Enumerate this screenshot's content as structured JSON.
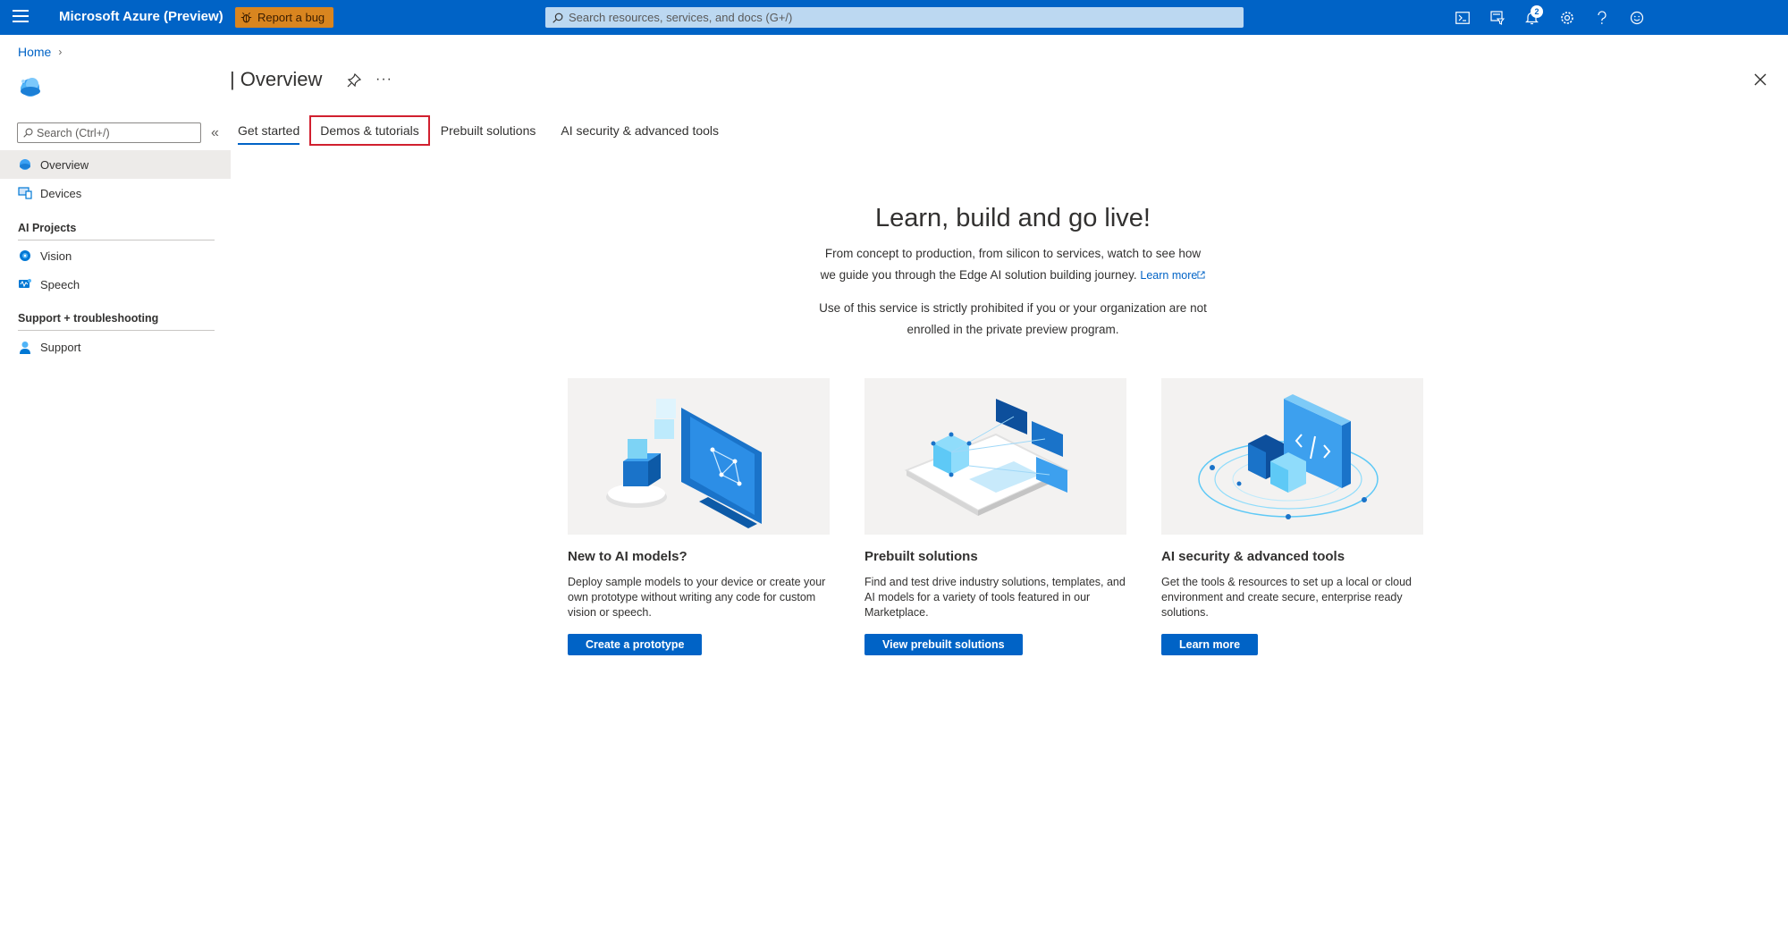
{
  "header": {
    "brand": "Microsoft Azure (Preview)",
    "report_bug": "Report a bug",
    "search_placeholder": "Search resources, services, and docs (G+/)",
    "notification_count": "2"
  },
  "breadcrumb": {
    "home": "Home"
  },
  "page": {
    "title": "Overview",
    "more": "···"
  },
  "sidebar": {
    "search_placeholder": "Search (Ctrl+/)",
    "collapse": "«",
    "items": [
      {
        "label": "Overview"
      },
      {
        "label": "Devices"
      }
    ],
    "sections": [
      {
        "title": "AI Projects",
        "items": [
          {
            "label": "Vision"
          },
          {
            "label": "Speech"
          }
        ]
      },
      {
        "title": "Support + troubleshooting",
        "items": [
          {
            "label": "Support"
          }
        ]
      }
    ]
  },
  "tabs": [
    {
      "label": "Get started"
    },
    {
      "label": "Demos & tutorials"
    },
    {
      "label": "Prebuilt solutions"
    },
    {
      "label": "AI security & advanced tools"
    }
  ],
  "hero": {
    "title": "Learn, build and go live!",
    "line1": "From concept to production, from silicon to services, watch to see how",
    "line2": "we guide you through the Edge AI solution building journey.",
    "learn_more": "Learn more",
    "notice1": "Use of this service is strictly prohibited if you or your organization are not",
    "notice2": "enrolled in the private preview program."
  },
  "cards": [
    {
      "title": "New to AI models?",
      "desc": "Deploy sample models to your device or create your own prototype without writing any code for custom vision or speech.",
      "button": "Create a prototype"
    },
    {
      "title": "Prebuilt solutions",
      "desc": "Find and test drive industry solutions, templates, and AI models for a variety of tools featured in our Marketplace.",
      "button": "View prebuilt solutions"
    },
    {
      "title": "AI security & advanced tools",
      "desc": "Get the tools & resources to set up a local or cloud environment and create secure, enterprise ready solutions.",
      "button": "Learn more"
    }
  ],
  "colors": {
    "accent": "#0063c6",
    "bug_button": "#d9851f",
    "tab_highlight": "#d1202f"
  }
}
